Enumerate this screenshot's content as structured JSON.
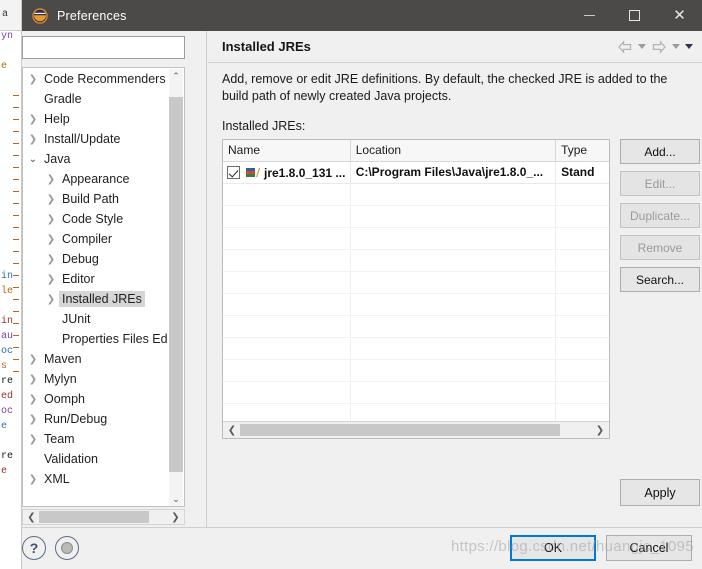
{
  "window": {
    "title": "Preferences",
    "icon": "eclipse-icon",
    "minimize_label": "—",
    "maximize_label": "□",
    "close_label": "✕"
  },
  "sidebar": {
    "filter": {
      "value": "",
      "placeholder": ""
    },
    "items": [
      {
        "label": "Code Recommenders",
        "indent": 0,
        "arrow": "right",
        "selected": false
      },
      {
        "label": "Gradle",
        "indent": 0,
        "arrow": "none",
        "selected": false
      },
      {
        "label": "Help",
        "indent": 0,
        "arrow": "right",
        "selected": false
      },
      {
        "label": "Install/Update",
        "indent": 0,
        "arrow": "right",
        "selected": false
      },
      {
        "label": "Java",
        "indent": 0,
        "arrow": "down",
        "selected": false
      },
      {
        "label": "Appearance",
        "indent": 1,
        "arrow": "right",
        "selected": false
      },
      {
        "label": "Build Path",
        "indent": 1,
        "arrow": "right",
        "selected": false
      },
      {
        "label": "Code Style",
        "indent": 1,
        "arrow": "right",
        "selected": false
      },
      {
        "label": "Compiler",
        "indent": 1,
        "arrow": "right",
        "selected": false
      },
      {
        "label": "Debug",
        "indent": 1,
        "arrow": "right",
        "selected": false
      },
      {
        "label": "Editor",
        "indent": 1,
        "arrow": "right",
        "selected": false
      },
      {
        "label": "Installed JREs",
        "indent": 1,
        "arrow": "right",
        "selected": true
      },
      {
        "label": "JUnit",
        "indent": 1,
        "arrow": "none",
        "selected": false
      },
      {
        "label": "Properties Files Ed",
        "indent": 1,
        "arrow": "none",
        "selected": false
      },
      {
        "label": "Maven",
        "indent": 0,
        "arrow": "right",
        "selected": false
      },
      {
        "label": "Mylyn",
        "indent": 0,
        "arrow": "right",
        "selected": false
      },
      {
        "label": "Oomph",
        "indent": 0,
        "arrow": "right",
        "selected": false
      },
      {
        "label": "Run/Debug",
        "indent": 0,
        "arrow": "right",
        "selected": false
      },
      {
        "label": "Team",
        "indent": 0,
        "arrow": "right",
        "selected": false
      },
      {
        "label": "Validation",
        "indent": 0,
        "arrow": "none",
        "selected": false
      },
      {
        "label": "XML",
        "indent": 0,
        "arrow": "right",
        "selected": false
      }
    ],
    "scroll_up_glyph": "⌃",
    "scroll_down_glyph": "⌄",
    "scroll_left_glyph": "❮",
    "scroll_right_glyph": "❯"
  },
  "page": {
    "title": "Installed JREs",
    "description": "Add, remove or edit JRE definitions. By default, the checked JRE is added to the build path of newly created Java projects.",
    "list_label": "Installed JREs:",
    "nav": {
      "back_icon": "back-arrow-icon",
      "back_menu_icon": "chevron-down-icon",
      "forward_icon": "forward-arrow-icon",
      "forward_menu_icon": "chevron-down-icon",
      "view_menu_icon": "view-menu-chevron-icon"
    }
  },
  "table": {
    "columns": [
      "Name",
      "Location",
      "Type"
    ],
    "rows": [
      {
        "checked": true,
        "name": "jre1.8.0_131 ...",
        "location": "C:\\Program Files\\Java\\jre1.8.0_...",
        "type": "Stand",
        "icon": "jre-library-icon"
      }
    ],
    "empty_row_count": 12,
    "scroll_left_glyph": "❮",
    "scroll_right_glyph": "❯"
  },
  "buttons": {
    "add": {
      "label": "Add...",
      "enabled": true
    },
    "edit": {
      "label": "Edit...",
      "enabled": false
    },
    "duplicate": {
      "label": "Duplicate...",
      "enabled": false
    },
    "remove": {
      "label": "Remove",
      "enabled": false
    },
    "search": {
      "label": "Search...",
      "enabled": true
    },
    "apply": {
      "label": "Apply",
      "enabled": true
    },
    "ok": {
      "label": "OK",
      "enabled": true,
      "default": true
    },
    "cancel": {
      "label": "Cancel",
      "enabled": true
    }
  },
  "footer": {
    "help_icon": "?",
    "help_icon_name": "help-icon",
    "restore_icon_name": "restore-defaults-icon"
  },
  "watermark": {
    "text": "https://blog.csdn.net/huangjc_1095"
  },
  "background": {
    "tab_text": "a",
    "code_lines": [
      "yn",
      "",
      "e",
      "",
      "",
      "",
      "",
      "",
      "",
      "",
      "",
      "",
      "",
      "",
      "",
      "",
      "in",
      "le",
      "",
      "in",
      "au",
      "oc",
      "s",
      "re",
      "ed",
      "oc",
      "e",
      "",
      "re",
      "e"
    ]
  },
  "colors": {
    "titlebar": "#4c4a48",
    "dialog_bg": "#f0f0f0",
    "accent_focus": "#0078d7",
    "selection": "#d6d6d6"
  }
}
